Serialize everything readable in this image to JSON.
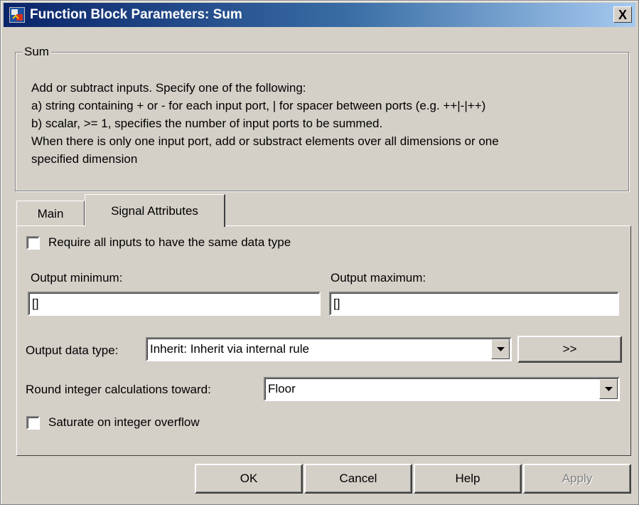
{
  "window": {
    "title": "Function Block Parameters: Sum",
    "close_symbol": "X"
  },
  "group": {
    "legend": "Sum",
    "description": [
      "Add or subtract inputs.  Specify one of the following:",
      "a) string containing + or - for each input port, | for spacer between ports (e.g. ++|-|++)",
      "b) scalar, >= 1, specifies the number of input ports to be summed.",
      "When there is only one input port, add or substract elements over all dimensions or one",
      "specified dimension"
    ]
  },
  "tabs": [
    {
      "label": "Main"
    },
    {
      "label": "Signal Attributes"
    }
  ],
  "signal_attributes": {
    "require_same_type_label": "Require all inputs to have the same data type",
    "output_min_label": "Output minimum:",
    "output_min_value": "[]",
    "output_max_label": "Output maximum:",
    "output_max_value": "[]",
    "output_data_type_label": "Output data type:",
    "output_data_type_value": "Inherit: Inherit via internal rule",
    "data_type_assistant_label": ">>",
    "round_label": "Round integer calculations toward:",
    "round_value": "Floor",
    "saturate_label": "Saturate on integer overflow"
  },
  "buttons": {
    "ok": "OK",
    "cancel": "Cancel",
    "help": "Help",
    "apply": "Apply"
  },
  "colors": {
    "title_start": "#0a246a",
    "title_end": "#a6caf0",
    "face": "#d4d0c8"
  }
}
